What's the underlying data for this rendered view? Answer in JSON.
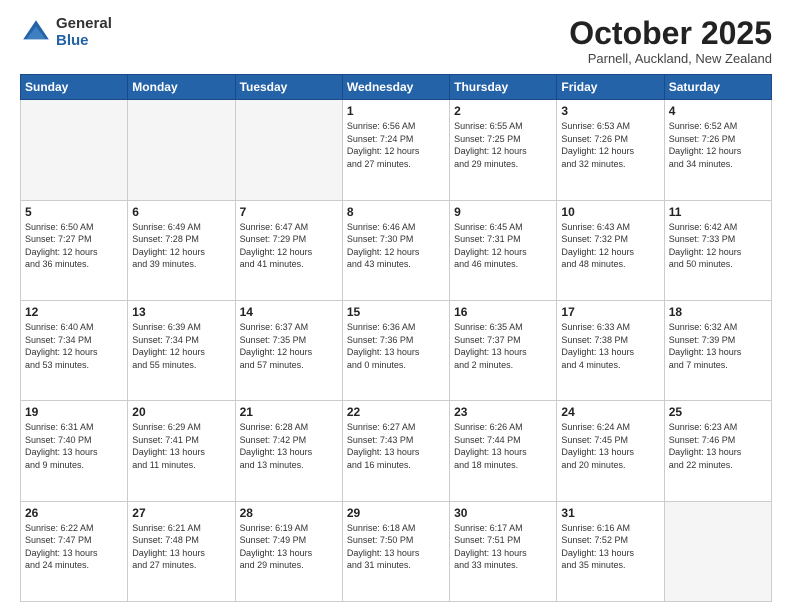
{
  "logo": {
    "general": "General",
    "blue": "Blue"
  },
  "header": {
    "month": "October 2025",
    "location": "Parnell, Auckland, New Zealand"
  },
  "weekdays": [
    "Sunday",
    "Monday",
    "Tuesday",
    "Wednesday",
    "Thursday",
    "Friday",
    "Saturday"
  ],
  "weeks": [
    [
      {
        "day": "",
        "info": ""
      },
      {
        "day": "",
        "info": ""
      },
      {
        "day": "",
        "info": ""
      },
      {
        "day": "1",
        "info": "Sunrise: 6:56 AM\nSunset: 7:24 PM\nDaylight: 12 hours\nand 27 minutes."
      },
      {
        "day": "2",
        "info": "Sunrise: 6:55 AM\nSunset: 7:25 PM\nDaylight: 12 hours\nand 29 minutes."
      },
      {
        "day": "3",
        "info": "Sunrise: 6:53 AM\nSunset: 7:26 PM\nDaylight: 12 hours\nand 32 minutes."
      },
      {
        "day": "4",
        "info": "Sunrise: 6:52 AM\nSunset: 7:26 PM\nDaylight: 12 hours\nand 34 minutes."
      }
    ],
    [
      {
        "day": "5",
        "info": "Sunrise: 6:50 AM\nSunset: 7:27 PM\nDaylight: 12 hours\nand 36 minutes."
      },
      {
        "day": "6",
        "info": "Sunrise: 6:49 AM\nSunset: 7:28 PM\nDaylight: 12 hours\nand 39 minutes."
      },
      {
        "day": "7",
        "info": "Sunrise: 6:47 AM\nSunset: 7:29 PM\nDaylight: 12 hours\nand 41 minutes."
      },
      {
        "day": "8",
        "info": "Sunrise: 6:46 AM\nSunset: 7:30 PM\nDaylight: 12 hours\nand 43 minutes."
      },
      {
        "day": "9",
        "info": "Sunrise: 6:45 AM\nSunset: 7:31 PM\nDaylight: 12 hours\nand 46 minutes."
      },
      {
        "day": "10",
        "info": "Sunrise: 6:43 AM\nSunset: 7:32 PM\nDaylight: 12 hours\nand 48 minutes."
      },
      {
        "day": "11",
        "info": "Sunrise: 6:42 AM\nSunset: 7:33 PM\nDaylight: 12 hours\nand 50 minutes."
      }
    ],
    [
      {
        "day": "12",
        "info": "Sunrise: 6:40 AM\nSunset: 7:34 PM\nDaylight: 12 hours\nand 53 minutes."
      },
      {
        "day": "13",
        "info": "Sunrise: 6:39 AM\nSunset: 7:34 PM\nDaylight: 12 hours\nand 55 minutes."
      },
      {
        "day": "14",
        "info": "Sunrise: 6:37 AM\nSunset: 7:35 PM\nDaylight: 12 hours\nand 57 minutes."
      },
      {
        "day": "15",
        "info": "Sunrise: 6:36 AM\nSunset: 7:36 PM\nDaylight: 13 hours\nand 0 minutes."
      },
      {
        "day": "16",
        "info": "Sunrise: 6:35 AM\nSunset: 7:37 PM\nDaylight: 13 hours\nand 2 minutes."
      },
      {
        "day": "17",
        "info": "Sunrise: 6:33 AM\nSunset: 7:38 PM\nDaylight: 13 hours\nand 4 minutes."
      },
      {
        "day": "18",
        "info": "Sunrise: 6:32 AM\nSunset: 7:39 PM\nDaylight: 13 hours\nand 7 minutes."
      }
    ],
    [
      {
        "day": "19",
        "info": "Sunrise: 6:31 AM\nSunset: 7:40 PM\nDaylight: 13 hours\nand 9 minutes."
      },
      {
        "day": "20",
        "info": "Sunrise: 6:29 AM\nSunset: 7:41 PM\nDaylight: 13 hours\nand 11 minutes."
      },
      {
        "day": "21",
        "info": "Sunrise: 6:28 AM\nSunset: 7:42 PM\nDaylight: 13 hours\nand 13 minutes."
      },
      {
        "day": "22",
        "info": "Sunrise: 6:27 AM\nSunset: 7:43 PM\nDaylight: 13 hours\nand 16 minutes."
      },
      {
        "day": "23",
        "info": "Sunrise: 6:26 AM\nSunset: 7:44 PM\nDaylight: 13 hours\nand 18 minutes."
      },
      {
        "day": "24",
        "info": "Sunrise: 6:24 AM\nSunset: 7:45 PM\nDaylight: 13 hours\nand 20 minutes."
      },
      {
        "day": "25",
        "info": "Sunrise: 6:23 AM\nSunset: 7:46 PM\nDaylight: 13 hours\nand 22 minutes."
      }
    ],
    [
      {
        "day": "26",
        "info": "Sunrise: 6:22 AM\nSunset: 7:47 PM\nDaylight: 13 hours\nand 24 minutes."
      },
      {
        "day": "27",
        "info": "Sunrise: 6:21 AM\nSunset: 7:48 PM\nDaylight: 13 hours\nand 27 minutes."
      },
      {
        "day": "28",
        "info": "Sunrise: 6:19 AM\nSunset: 7:49 PM\nDaylight: 13 hours\nand 29 minutes."
      },
      {
        "day": "29",
        "info": "Sunrise: 6:18 AM\nSunset: 7:50 PM\nDaylight: 13 hours\nand 31 minutes."
      },
      {
        "day": "30",
        "info": "Sunrise: 6:17 AM\nSunset: 7:51 PM\nDaylight: 13 hours\nand 33 minutes."
      },
      {
        "day": "31",
        "info": "Sunrise: 6:16 AM\nSunset: 7:52 PM\nDaylight: 13 hours\nand 35 minutes."
      },
      {
        "day": "",
        "info": ""
      }
    ]
  ]
}
